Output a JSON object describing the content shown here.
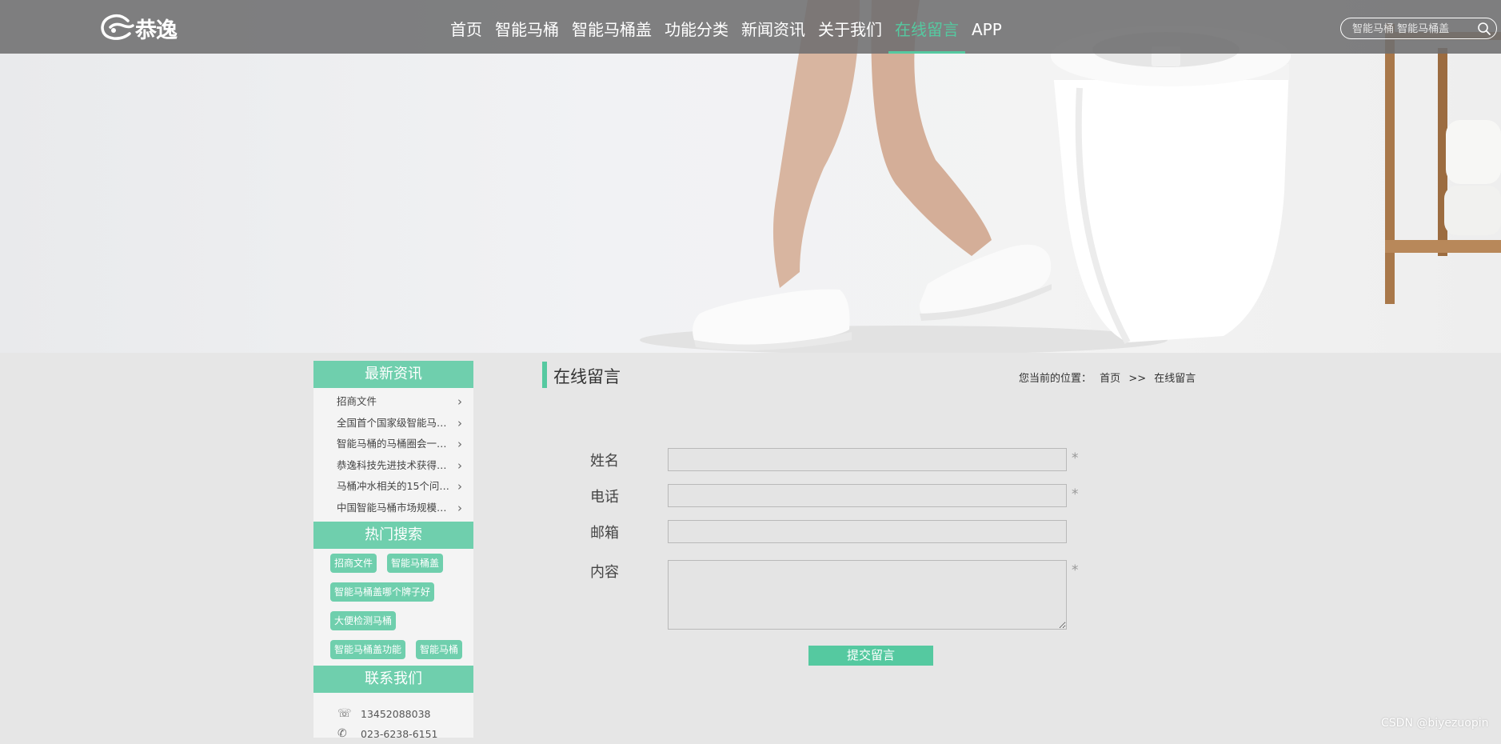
{
  "header": {
    "logo_text": "恭逸",
    "nav": [
      {
        "label": "首页"
      },
      {
        "label": "智能马桶"
      },
      {
        "label": "智能马桶盖"
      },
      {
        "label": "功能分类"
      },
      {
        "label": "新闻资讯"
      },
      {
        "label": "关于我们"
      },
      {
        "label": "在线留言",
        "active": true
      },
      {
        "label": "APP"
      }
    ],
    "search": {
      "placeholder": "智能马桶 智能马桶盖"
    }
  },
  "sidebar": {
    "news": {
      "title": "最新资讯",
      "items": [
        {
          "label": "招商文件"
        },
        {
          "label": "全国首个国家级智能马…"
        },
        {
          "label": "智能马桶的马桶圈会一…"
        },
        {
          "label": "恭逸科技先进技术获得…"
        },
        {
          "label": "马桶冲水相关的15个问…"
        },
        {
          "label": "中国智能马桶市场规模…"
        }
      ]
    },
    "hot": {
      "title": "热门搜索",
      "tags": [
        "招商文件",
        "智能马桶盖",
        "智能马桶盖哪个牌子好",
        "大便检测马桶",
        "智能马桶盖功能",
        "智能马桶"
      ]
    },
    "contact": {
      "title": "联系我们",
      "mobile": "13452088038",
      "phone": "023-6238-6151"
    }
  },
  "main": {
    "title": "在线留言",
    "breadcrumb": {
      "prefix": "您当前的位置：",
      "home": "首页",
      "sep": ">>",
      "current": "在线留言"
    },
    "form": {
      "name_label": "姓名",
      "phone_label": "电话",
      "email_label": "邮箱",
      "content_label": "内容",
      "required_mark": "*",
      "submit_label": "提交留言"
    }
  },
  "watermark": "CSDN @biyezuopin",
  "colors": {
    "accent": "#55c9a0",
    "side_head": "#6fcfad",
    "header_bg": "#6e6e70"
  }
}
